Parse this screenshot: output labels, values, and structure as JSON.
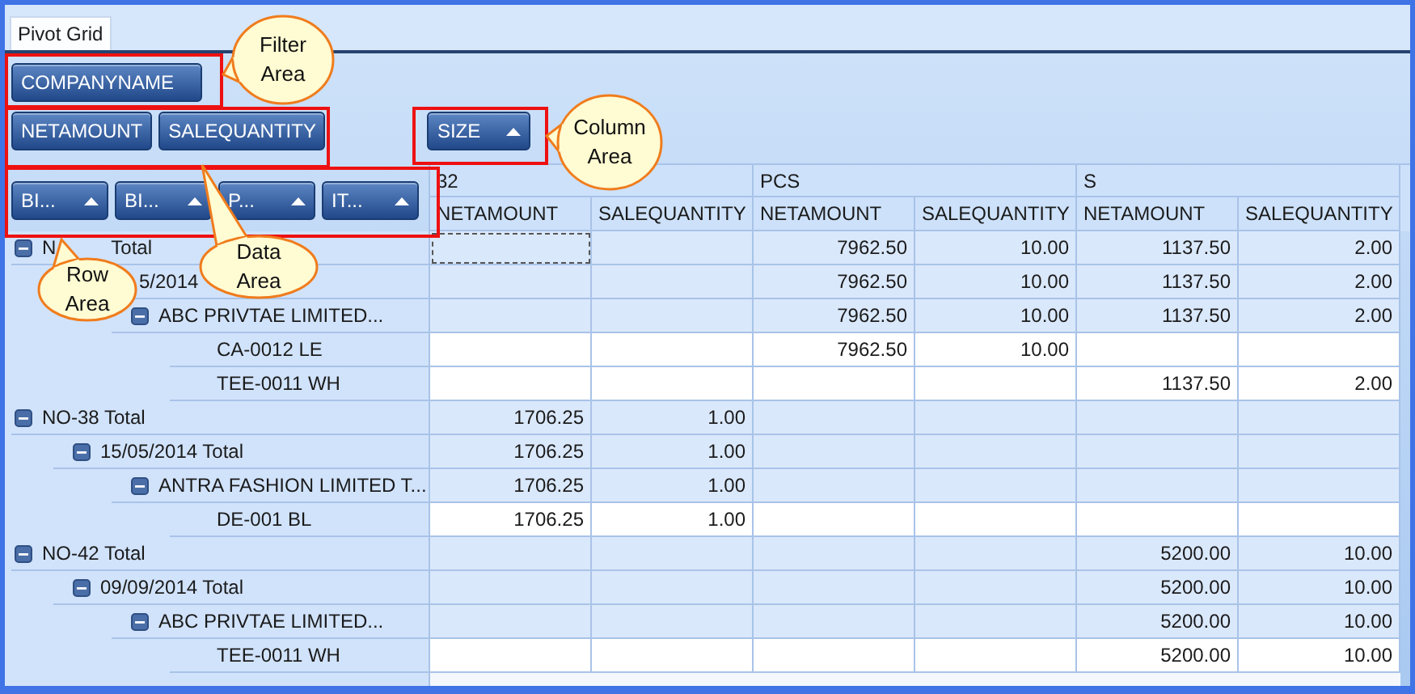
{
  "tab": {
    "label": "Pivot Grid",
    "selected": true
  },
  "filter_fields": [
    {
      "label": "COMPANYNAME"
    }
  ],
  "data_fields": [
    {
      "label": "NETAMOUNT"
    },
    {
      "label": "SALEQUANTITY"
    }
  ],
  "column_fields": [
    {
      "label": "SIZE",
      "sort_ascending": true
    }
  ],
  "row_fields": [
    {
      "label": "BI...",
      "sort_ascending": true
    },
    {
      "label": "BI...",
      "sort_ascending": true
    },
    {
      "label": "P...",
      "sort_ascending": true
    },
    {
      "label": "IT...",
      "sort_ascending": true
    }
  ],
  "column_groups": [
    "32",
    "PCS",
    "S"
  ],
  "measures": [
    "NETAMOUNT",
    "SALEQUANTITY",
    "NETAMOUNT",
    "SALEQUANTITY",
    "NETAMOUNT",
    "SALEQUANTITY"
  ],
  "rows": [
    {
      "label": "N",
      "label_tail": "Total",
      "expanded": true,
      "focused": true,
      "values": {
        "column_3": "7962.50",
        "column_4": "10.00",
        "column_5": "1137.50",
        "column_6": "2.00"
      },
      "children": [
        {
          "label_tail": "5/2014",
          "values": {
            "column_3": "7962.50",
            "column_4": "10.00",
            "column_5": "1137.50",
            "column_6": "2.00"
          },
          "children": [
            {
              "label": "ABC PRIVTAE LIMITED...",
              "expanded": true,
              "values": {
                "column_3": "7962.50",
                "column_4": "10.00",
                "column_5": "1137.50",
                "column_6": "2.00"
              },
              "children": [
                {
                  "label": "CA-0012 LE",
                  "values": {
                    "column_3": "7962.50",
                    "column_4": "10.00"
                  }
                },
                {
                  "label": "TEE-0011 WH",
                  "values": {
                    "column_5": "1137.50",
                    "column_6": "2.00"
                  }
                }
              ]
            }
          ]
        }
      ]
    },
    {
      "label": "NO-38 Total",
      "expanded": true,
      "values": {
        "column_1": "1706.25",
        "column_2": "1.00"
      },
      "children": [
        {
          "label": "15/05/2014 Total",
          "expanded": true,
          "values": {
            "column_1": "1706.25",
            "column_2": "1.00"
          },
          "children": [
            {
              "label": "ANTRA FASHION LIMITED T...",
              "expanded": true,
              "values": {
                "column_1": "1706.25",
                "column_2": "1.00"
              },
              "children": [
                {
                  "label": "DE-001 BL",
                  "values": {
                    "column_1": "1706.25",
                    "column_2": "1.00"
                  }
                }
              ]
            }
          ]
        }
      ]
    },
    {
      "label": "NO-42 Total",
      "expanded": true,
      "values": {
        "column_5": "5200.00",
        "column_6": "10.00"
      },
      "children": [
        {
          "label": "09/09/2014 Total",
          "expanded": true,
          "values": {
            "column_5": "5200.00",
            "column_6": "10.00"
          },
          "children": [
            {
              "label": "ABC PRIVTAE LIMITED...",
              "expanded": true,
              "values": {
                "column_5": "5200.00",
                "column_6": "10.00"
              },
              "children": [
                {
                  "label": "TEE-0011 WH",
                  "values": {
                    "column_5": "5200.00",
                    "column_6": "10.00"
                  }
                }
              ]
            }
          ]
        }
      ]
    }
  ],
  "callouts": [
    {
      "lines": [
        "Filter",
        "Area"
      ]
    },
    {
      "lines": [
        "Column",
        "Area"
      ]
    },
    {
      "lines": [
        "Row",
        "Area"
      ]
    },
    {
      "lines": [
        "Data",
        "Area"
      ]
    }
  ]
}
